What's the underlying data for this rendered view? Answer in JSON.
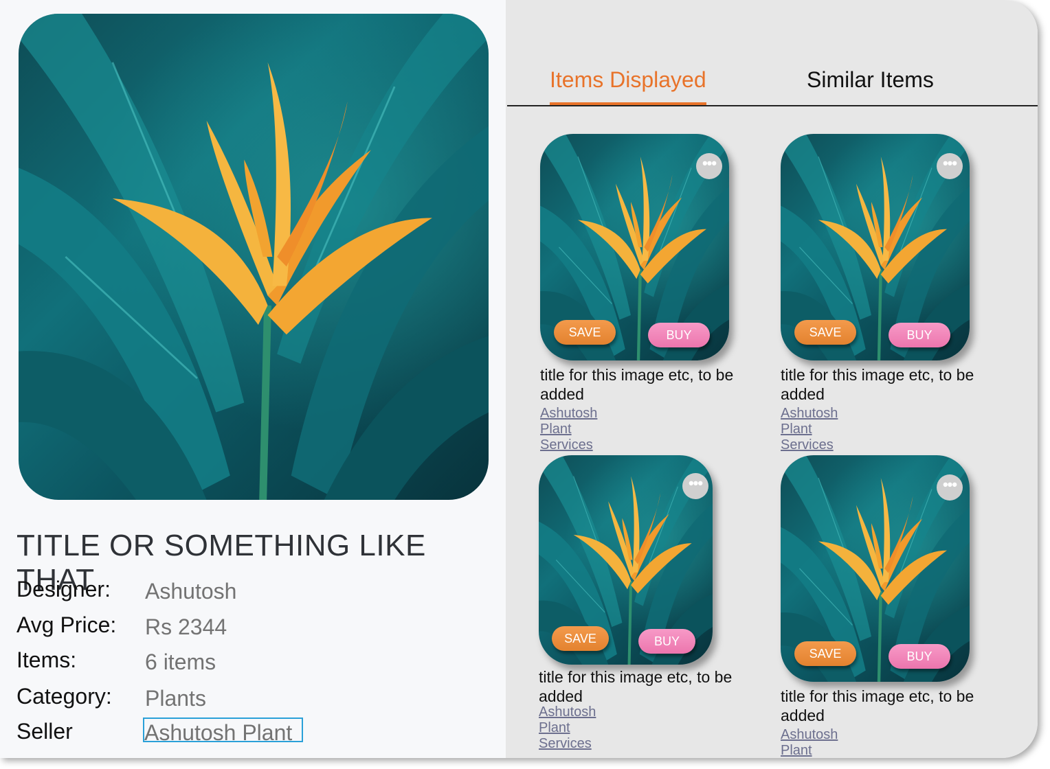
{
  "detail": {
    "title": "TITLE OR SOMETHING LIKE THAT",
    "rows": [
      {
        "label": "Designer:",
        "value": "Ashutosh"
      },
      {
        "label": "Avg Price:",
        "value": "Rs 2344"
      },
      {
        "label": "Items:",
        "value": "6 items"
      },
      {
        "label": "Category:",
        "value": "Plants"
      },
      {
        "label": "Seller",
        "value": "Ashutosh Plant"
      }
    ]
  },
  "tabs": [
    {
      "label": "Items Displayed",
      "active": true
    },
    {
      "label": "Similar Items",
      "active": false
    }
  ],
  "cards": [
    {
      "title": "title for this image etc, to be added",
      "seller": "Ashutosh Plant Services",
      "save": "SAVE",
      "buy": "BUY",
      "more": "•••"
    },
    {
      "title": "title for this image etc, to be added",
      "seller": "Ashutosh Plant Services",
      "save": "SAVE",
      "buy": "BUY",
      "more": "•••"
    },
    {
      "title": "title for this image etc, to be added",
      "seller": "Ashutosh Plant Services",
      "save": "SAVE",
      "buy": "BUY",
      "more": "•••"
    },
    {
      "title": "title for this image etc, to be added",
      "seller": "Ashutosh Plant Services",
      "save": "SAVE",
      "buy": "BUY",
      "more": "•••"
    }
  ],
  "colors": {
    "accent": "#e8732a",
    "save": "#e8852f",
    "buy": "#f08abb",
    "link": "#6c6f8e"
  }
}
